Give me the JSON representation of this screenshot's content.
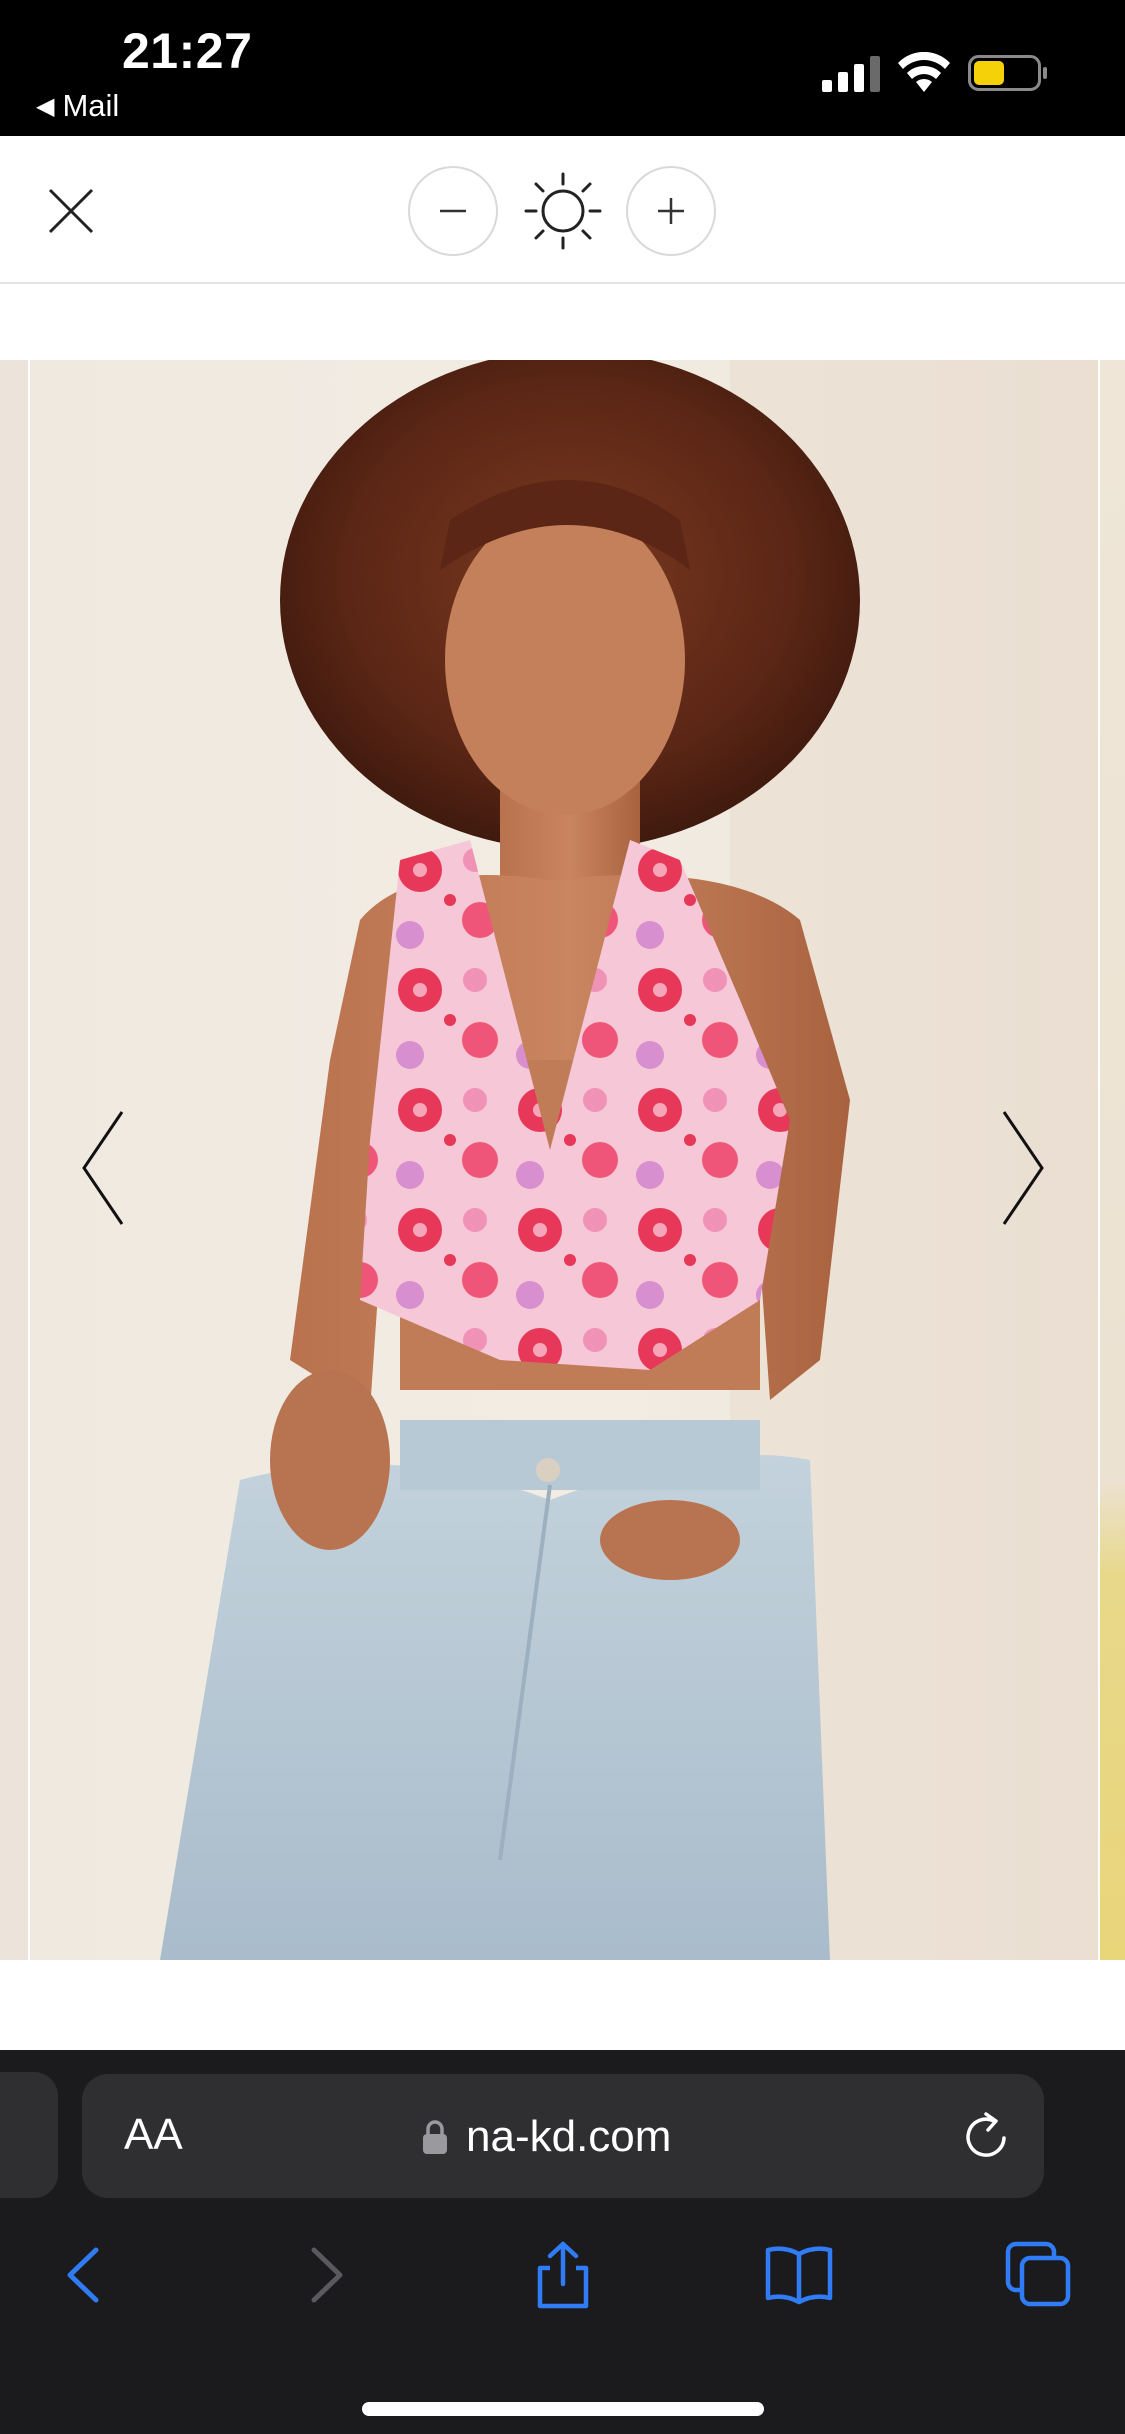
{
  "status_bar": {
    "time": "21:27",
    "back_app": "Mail",
    "back_icon": "back-triangle-icon",
    "battery_color": "#f5d10a"
  },
  "viewer": {
    "close_icon": "close-icon",
    "zoom_out_icon": "minus-icon",
    "brightness_icon": "brightness-icon",
    "zoom_in_icon": "plus-icon",
    "prev_icon": "chevron-left-icon",
    "next_icon": "chevron-right-icon"
  },
  "gallery": {
    "image_subject": "model in pink floral halter top and light wash jeans"
  },
  "safari": {
    "text_size_label": "AA",
    "url": "na-kd.com",
    "lock_icon": "lock-icon",
    "reload_icon": "reload-icon",
    "toolbar": {
      "back_icon": "back-icon",
      "forward_icon": "forward-icon",
      "share_icon": "share-icon",
      "bookmarks_icon": "bookmarks-icon",
      "tabs_icon": "tabs-icon"
    },
    "accent_color": "#2f7cf6",
    "disabled_color": "#5a5a5e"
  }
}
